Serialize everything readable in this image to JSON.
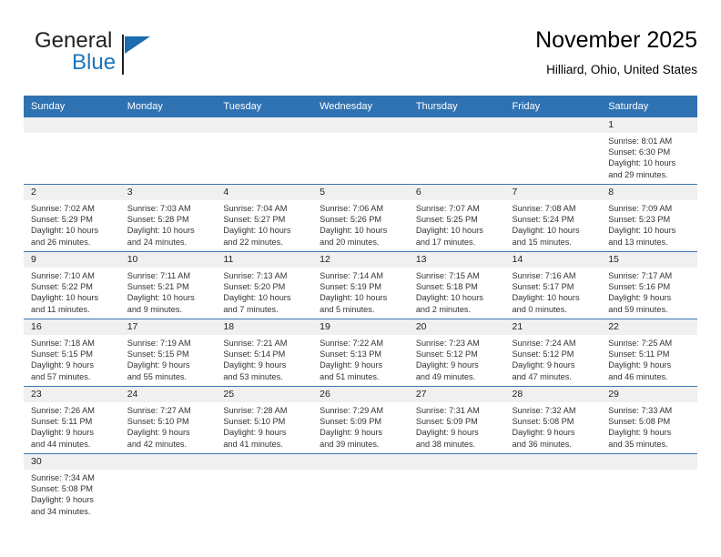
{
  "brand": {
    "name_part1": "General",
    "name_part2": "Blue",
    "logo_icon": "triangle-flag-icon"
  },
  "header": {
    "title": "November 2025",
    "location": "Hilliard, Ohio, United States"
  },
  "calendar": {
    "weekday_headers": [
      "Sunday",
      "Monday",
      "Tuesday",
      "Wednesday",
      "Thursday",
      "Friday",
      "Saturday"
    ],
    "accent_header_color": "#2f72b2",
    "row_divider_color": "#3a78b5",
    "daynum_band_color": "#f0f0f0",
    "weeks": [
      [
        {
          "day": "",
          "lines": []
        },
        {
          "day": "",
          "lines": []
        },
        {
          "day": "",
          "lines": []
        },
        {
          "day": "",
          "lines": []
        },
        {
          "day": "",
          "lines": []
        },
        {
          "day": "",
          "lines": []
        },
        {
          "day": "1",
          "lines": [
            "Sunrise: 8:01 AM",
            "Sunset: 6:30 PM",
            "Daylight: 10 hours",
            "and 29 minutes."
          ]
        }
      ],
      [
        {
          "day": "2",
          "lines": [
            "Sunrise: 7:02 AM",
            "Sunset: 5:29 PM",
            "Daylight: 10 hours",
            "and 26 minutes."
          ]
        },
        {
          "day": "3",
          "lines": [
            "Sunrise: 7:03 AM",
            "Sunset: 5:28 PM",
            "Daylight: 10 hours",
            "and 24 minutes."
          ]
        },
        {
          "day": "4",
          "lines": [
            "Sunrise: 7:04 AM",
            "Sunset: 5:27 PM",
            "Daylight: 10 hours",
            "and 22 minutes."
          ]
        },
        {
          "day": "5",
          "lines": [
            "Sunrise: 7:06 AM",
            "Sunset: 5:26 PM",
            "Daylight: 10 hours",
            "and 20 minutes."
          ]
        },
        {
          "day": "6",
          "lines": [
            "Sunrise: 7:07 AM",
            "Sunset: 5:25 PM",
            "Daylight: 10 hours",
            "and 17 minutes."
          ]
        },
        {
          "day": "7",
          "lines": [
            "Sunrise: 7:08 AM",
            "Sunset: 5:24 PM",
            "Daylight: 10 hours",
            "and 15 minutes."
          ]
        },
        {
          "day": "8",
          "lines": [
            "Sunrise: 7:09 AM",
            "Sunset: 5:23 PM",
            "Daylight: 10 hours",
            "and 13 minutes."
          ]
        }
      ],
      [
        {
          "day": "9",
          "lines": [
            "Sunrise: 7:10 AM",
            "Sunset: 5:22 PM",
            "Daylight: 10 hours",
            "and 11 minutes."
          ]
        },
        {
          "day": "10",
          "lines": [
            "Sunrise: 7:11 AM",
            "Sunset: 5:21 PM",
            "Daylight: 10 hours",
            "and 9 minutes."
          ]
        },
        {
          "day": "11",
          "lines": [
            "Sunrise: 7:13 AM",
            "Sunset: 5:20 PM",
            "Daylight: 10 hours",
            "and 7 minutes."
          ]
        },
        {
          "day": "12",
          "lines": [
            "Sunrise: 7:14 AM",
            "Sunset: 5:19 PM",
            "Daylight: 10 hours",
            "and 5 minutes."
          ]
        },
        {
          "day": "13",
          "lines": [
            "Sunrise: 7:15 AM",
            "Sunset: 5:18 PM",
            "Daylight: 10 hours",
            "and 2 minutes."
          ]
        },
        {
          "day": "14",
          "lines": [
            "Sunrise: 7:16 AM",
            "Sunset: 5:17 PM",
            "Daylight: 10 hours",
            "and 0 minutes."
          ]
        },
        {
          "day": "15",
          "lines": [
            "Sunrise: 7:17 AM",
            "Sunset: 5:16 PM",
            "Daylight: 9 hours",
            "and 59 minutes."
          ]
        }
      ],
      [
        {
          "day": "16",
          "lines": [
            "Sunrise: 7:18 AM",
            "Sunset: 5:15 PM",
            "Daylight: 9 hours",
            "and 57 minutes."
          ]
        },
        {
          "day": "17",
          "lines": [
            "Sunrise: 7:19 AM",
            "Sunset: 5:15 PM",
            "Daylight: 9 hours",
            "and 55 minutes."
          ]
        },
        {
          "day": "18",
          "lines": [
            "Sunrise: 7:21 AM",
            "Sunset: 5:14 PM",
            "Daylight: 9 hours",
            "and 53 minutes."
          ]
        },
        {
          "day": "19",
          "lines": [
            "Sunrise: 7:22 AM",
            "Sunset: 5:13 PM",
            "Daylight: 9 hours",
            "and 51 minutes."
          ]
        },
        {
          "day": "20",
          "lines": [
            "Sunrise: 7:23 AM",
            "Sunset: 5:12 PM",
            "Daylight: 9 hours",
            "and 49 minutes."
          ]
        },
        {
          "day": "21",
          "lines": [
            "Sunrise: 7:24 AM",
            "Sunset: 5:12 PM",
            "Daylight: 9 hours",
            "and 47 minutes."
          ]
        },
        {
          "day": "22",
          "lines": [
            "Sunrise: 7:25 AM",
            "Sunset: 5:11 PM",
            "Daylight: 9 hours",
            "and 46 minutes."
          ]
        }
      ],
      [
        {
          "day": "23",
          "lines": [
            "Sunrise: 7:26 AM",
            "Sunset: 5:11 PM",
            "Daylight: 9 hours",
            "and 44 minutes."
          ]
        },
        {
          "day": "24",
          "lines": [
            "Sunrise: 7:27 AM",
            "Sunset: 5:10 PM",
            "Daylight: 9 hours",
            "and 42 minutes."
          ]
        },
        {
          "day": "25",
          "lines": [
            "Sunrise: 7:28 AM",
            "Sunset: 5:10 PM",
            "Daylight: 9 hours",
            "and 41 minutes."
          ]
        },
        {
          "day": "26",
          "lines": [
            "Sunrise: 7:29 AM",
            "Sunset: 5:09 PM",
            "Daylight: 9 hours",
            "and 39 minutes."
          ]
        },
        {
          "day": "27",
          "lines": [
            "Sunrise: 7:31 AM",
            "Sunset: 5:09 PM",
            "Daylight: 9 hours",
            "and 38 minutes."
          ]
        },
        {
          "day": "28",
          "lines": [
            "Sunrise: 7:32 AM",
            "Sunset: 5:08 PM",
            "Daylight: 9 hours",
            "and 36 minutes."
          ]
        },
        {
          "day": "29",
          "lines": [
            "Sunrise: 7:33 AM",
            "Sunset: 5:08 PM",
            "Daylight: 9 hours",
            "and 35 minutes."
          ]
        }
      ],
      [
        {
          "day": "30",
          "lines": [
            "Sunrise: 7:34 AM",
            "Sunset: 5:08 PM",
            "Daylight: 9 hours",
            "and 34 minutes."
          ]
        },
        {
          "day": "",
          "lines": []
        },
        {
          "day": "",
          "lines": []
        },
        {
          "day": "",
          "lines": []
        },
        {
          "day": "",
          "lines": []
        },
        {
          "day": "",
          "lines": []
        },
        {
          "day": "",
          "lines": []
        }
      ]
    ]
  }
}
